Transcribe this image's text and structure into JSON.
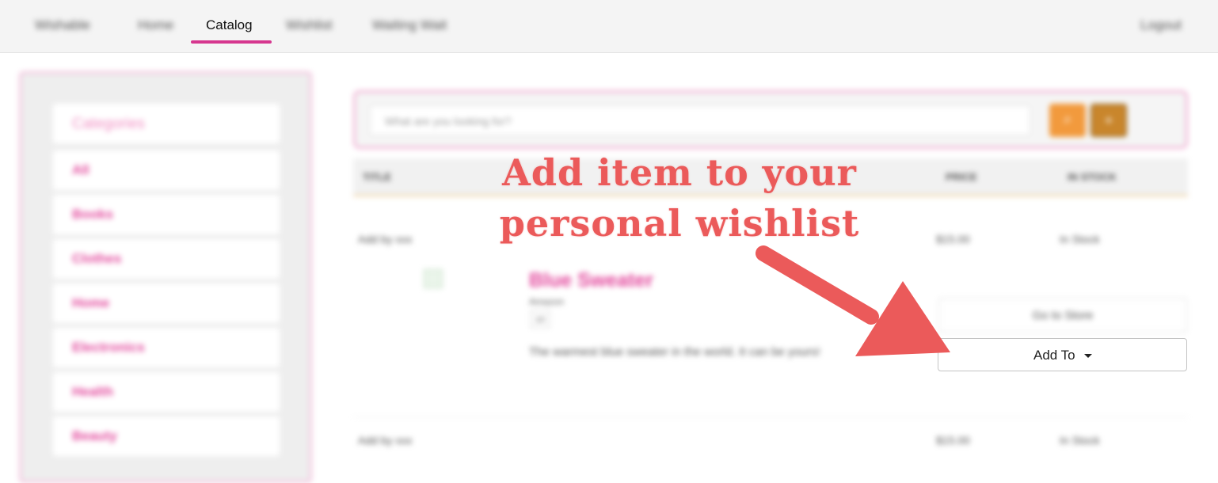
{
  "nav": {
    "brand": "Wishable",
    "home": "Home",
    "catalog": "Catalog",
    "wishlist": "Wishlist",
    "waiting_list": "Waiting Wait",
    "logout": "Logout"
  },
  "sidebar": {
    "heading": "Categories",
    "items": [
      {
        "label": "All"
      },
      {
        "label": "Books"
      },
      {
        "label": "Clothes"
      },
      {
        "label": "Home"
      },
      {
        "label": "Electronics"
      },
      {
        "label": "Health"
      },
      {
        "label": "Beauty"
      }
    ]
  },
  "search": {
    "placeholder": "What are you looking for?",
    "search_icon": "search-icon",
    "add_icon": "plus-icon"
  },
  "table": {
    "headers": {
      "title": "TITLE",
      "price": "PRICE",
      "stock": "IN STOCK"
    },
    "rows": [
      {
        "meta": "Add by xxx",
        "price": "$15.00",
        "stock": "In Stock",
        "title": "Blue Sweater",
        "subtitle": "Amazon",
        "qty": "10",
        "description": "The warmest blue sweater in the world. It can be yours!",
        "go_store": "Go to Store",
        "add_to": "Add To"
      },
      {
        "meta": "Add by xxx",
        "price": "$15.00",
        "stock": "In Stock"
      }
    ]
  },
  "annotation": {
    "line1": "Add item to your",
    "line2": "personal wishlist",
    "color": "#eb5a5a"
  },
  "colors": {
    "accent": "#d6378f",
    "category_text": "#e2479c",
    "search_button": "#f29a3d"
  }
}
